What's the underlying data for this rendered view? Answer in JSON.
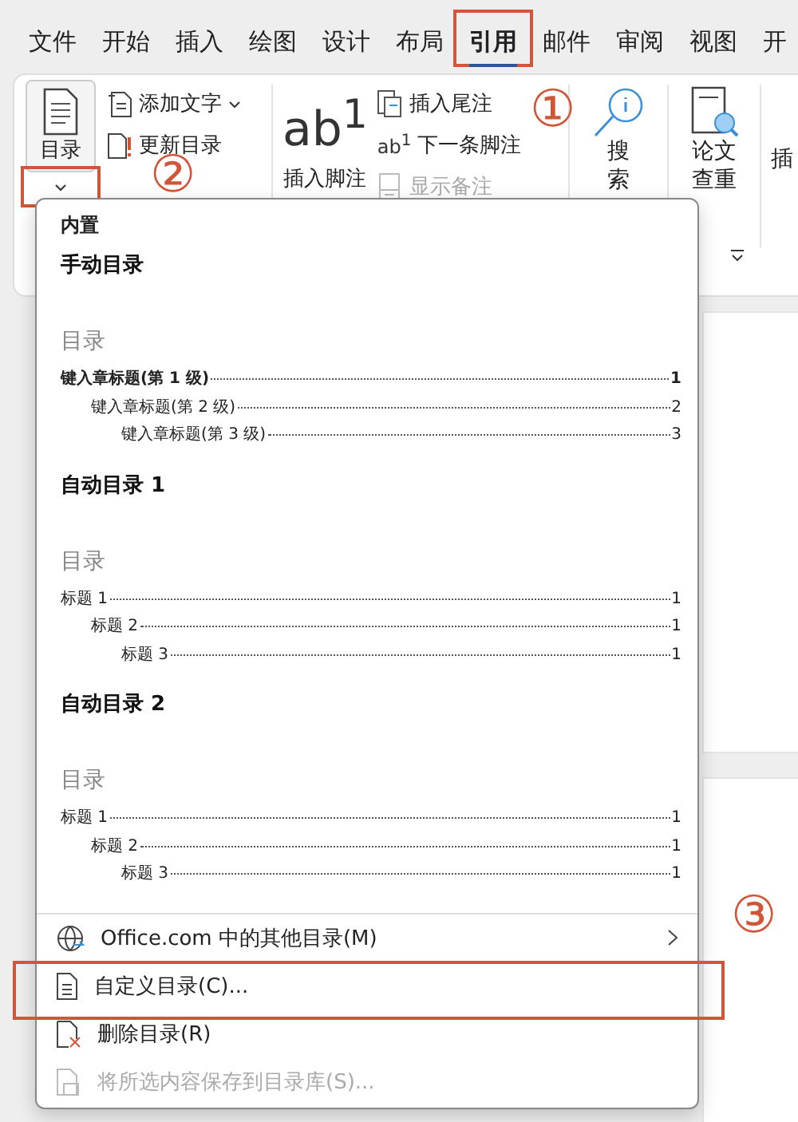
{
  "tabs": [
    {
      "label": "文件",
      "selected": false,
      "highlighted": false
    },
    {
      "label": "开始",
      "selected": false,
      "highlighted": false
    },
    {
      "label": "插入",
      "selected": false,
      "highlighted": false
    },
    {
      "label": "绘图",
      "selected": false,
      "highlighted": false
    },
    {
      "label": "设计",
      "selected": false,
      "highlighted": false
    },
    {
      "label": "布局",
      "selected": false,
      "highlighted": false
    },
    {
      "label": "引用",
      "selected": true,
      "highlighted": true
    },
    {
      "label": "邮件",
      "selected": false,
      "highlighted": false
    },
    {
      "label": "审阅",
      "selected": false,
      "highlighted": false
    },
    {
      "label": "视图",
      "selected": false,
      "highlighted": false
    },
    {
      "label": "开",
      "selected": false,
      "highlighted": false
    }
  ],
  "ribbon": {
    "toc": {
      "label": "目录",
      "caret_highlighted": true
    },
    "toc_actions": [
      {
        "kind": "add",
        "label": "添加文字",
        "dropdown": true
      },
      {
        "kind": "update",
        "label": "更新目录",
        "dropdown": false
      }
    ],
    "footnote": {
      "glyph": "ab$^{1}$",
      "label": "插入脚注"
    },
    "footnote_actions": [
      {
        "kind": "endnote",
        "label": "插入尾注",
        "disabled": false
      },
      {
        "kind": "next",
        "glyph": "ab$^{1}$",
        "label": "下一条脚注",
        "disabled": false
      },
      {
        "kind": "show",
        "label": "显示备注",
        "disabled": true
      }
    ],
    "search": {
      "label": "搜索"
    },
    "check": {
      "label": "论文查重"
    },
    "insert": {
      "label": "插"
    }
  },
  "menu": {
    "header": "内置",
    "styles": [
      {
        "title": "手动目录",
        "heading": "目录",
        "entries": [
          {
            "text": "键入章标题(第 1 级)",
            "page": "1",
            "bold": true,
            "children": [
              {
                "text": "键入章标题(第 2 级)",
                "page": "2",
                "bold": false,
                "children": [
                  {
                    "text": "键入章标题(第 3 级)",
                    "page": "3",
                    "bold": false
                  }
                ]
              }
            ]
          }
        ]
      },
      {
        "title": "自动目录 1",
        "heading": "目录",
        "entries": [
          {
            "text": "标题 1",
            "page": "1",
            "bold": false,
            "children": [
              {
                "text": "标题 2",
                "page": "1",
                "bold": false,
                "children": [
                  {
                    "text": "标题 3",
                    "page": "1",
                    "bold": false
                  }
                ]
              }
            ]
          }
        ]
      },
      {
        "title": "自动目录 2",
        "heading": "目录",
        "entries": [
          {
            "text": "标题 1",
            "page": "1",
            "bold": false,
            "children": [
              {
                "text": "标题 2",
                "page": "1",
                "bold": false,
                "children": [
                  {
                    "text": "标题 3",
                    "page": "1",
                    "bold": false
                  }
                ]
              }
            ]
          }
        ]
      }
    ],
    "items": [
      {
        "kind": "globe",
        "label": "Office.com 中的其他目录(M)",
        "submenu": true,
        "disabled": false,
        "highlighted": false
      },
      {
        "kind": "custom",
        "label": "自定义目录(C)...",
        "submenu": false,
        "disabled": false,
        "highlighted": true
      },
      {
        "kind": "delete",
        "label": "删除目录(R)",
        "submenu": false,
        "disabled": false,
        "highlighted": false
      },
      {
        "kind": "save",
        "label": "将所选内容保存到目录库(S)...",
        "submenu": false,
        "disabled": true,
        "highlighted": false
      }
    ]
  },
  "markers": [
    "①",
    "②",
    "③"
  ]
}
